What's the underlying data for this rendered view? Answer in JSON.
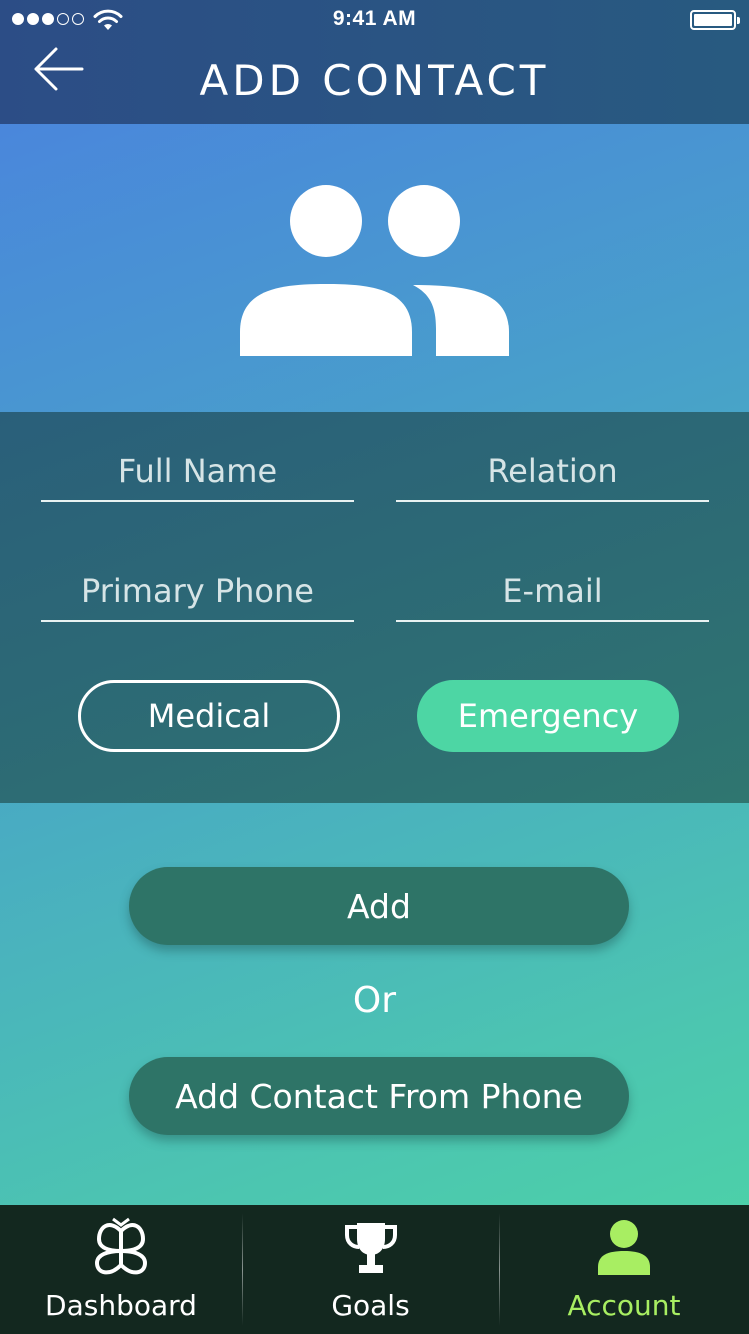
{
  "status_bar": {
    "time": "9:41 AM",
    "signal_bars": 5,
    "signal_filled": 3
  },
  "header": {
    "title": "ADD CONTACT",
    "back_icon": "arrow-left-icon"
  },
  "avatar": {
    "icon": "contacts-group-icon"
  },
  "form": {
    "full_name": {
      "placeholder": "Full Name",
      "value": ""
    },
    "relation": {
      "placeholder": "Relation",
      "value": ""
    },
    "primary_phone": {
      "placeholder": "Primary Phone",
      "value": ""
    },
    "email": {
      "placeholder": "E-mail",
      "value": ""
    },
    "types": [
      {
        "label": "Medical",
        "selected": false
      },
      {
        "label": "Emergency",
        "selected": true
      }
    ]
  },
  "actions": {
    "add_label": "Add",
    "or_label": "Or",
    "from_phone_label": "Add Contact From Phone"
  },
  "tabbar": {
    "items": [
      {
        "label": "Dashboard",
        "icon": "dashboard-knot-icon",
        "active": false
      },
      {
        "label": "Goals",
        "icon": "trophy-icon",
        "active": false
      },
      {
        "label": "Account",
        "icon": "person-icon",
        "active": true
      }
    ]
  },
  "colors": {
    "accent_green": "#4dd6a4",
    "active_tab": "#a8ee62",
    "button": "#2e7467",
    "tabbar_bg": "#13281f"
  }
}
